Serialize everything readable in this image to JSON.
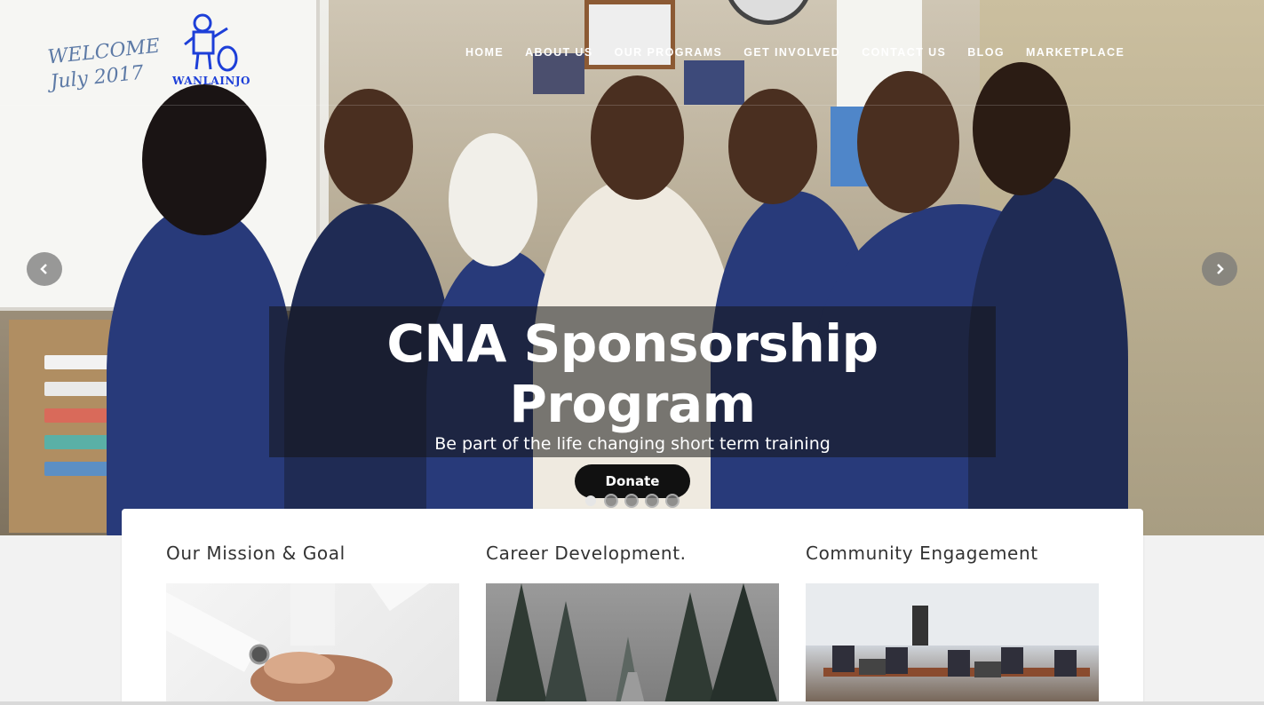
{
  "brand": {
    "logo_text": "WANLAINJO",
    "logo_color": "#1d3fd8"
  },
  "nav": {
    "items": [
      {
        "label": "HOME"
      },
      {
        "label": "ABOUT US"
      },
      {
        "label": "OUR PROGRAMS"
      },
      {
        "label": "GET INVOLVED"
      },
      {
        "label": "CONTACT US"
      },
      {
        "label": "BLOG"
      },
      {
        "label": "MARKETPLACE"
      }
    ]
  },
  "hero": {
    "whiteboard_text": "WELCOME\nJuly 2017",
    "title": "CNA Sponsorship Program",
    "subtitle": "Be part of the life changing short term training",
    "cta_label": "Donate",
    "prev_icon": "chevron-left-icon",
    "next_icon": "chevron-right-icon",
    "slide_count": 5,
    "active_slide": 1
  },
  "cards": [
    {
      "title": "Our Mission & Goal"
    },
    {
      "title": "Career Development."
    },
    {
      "title": "Community Engagement"
    }
  ],
  "colors": {
    "caption_bg": "rgba(20,20,20,0.55)",
    "cta_bg": "#111111",
    "card_bg": "#ffffff"
  }
}
